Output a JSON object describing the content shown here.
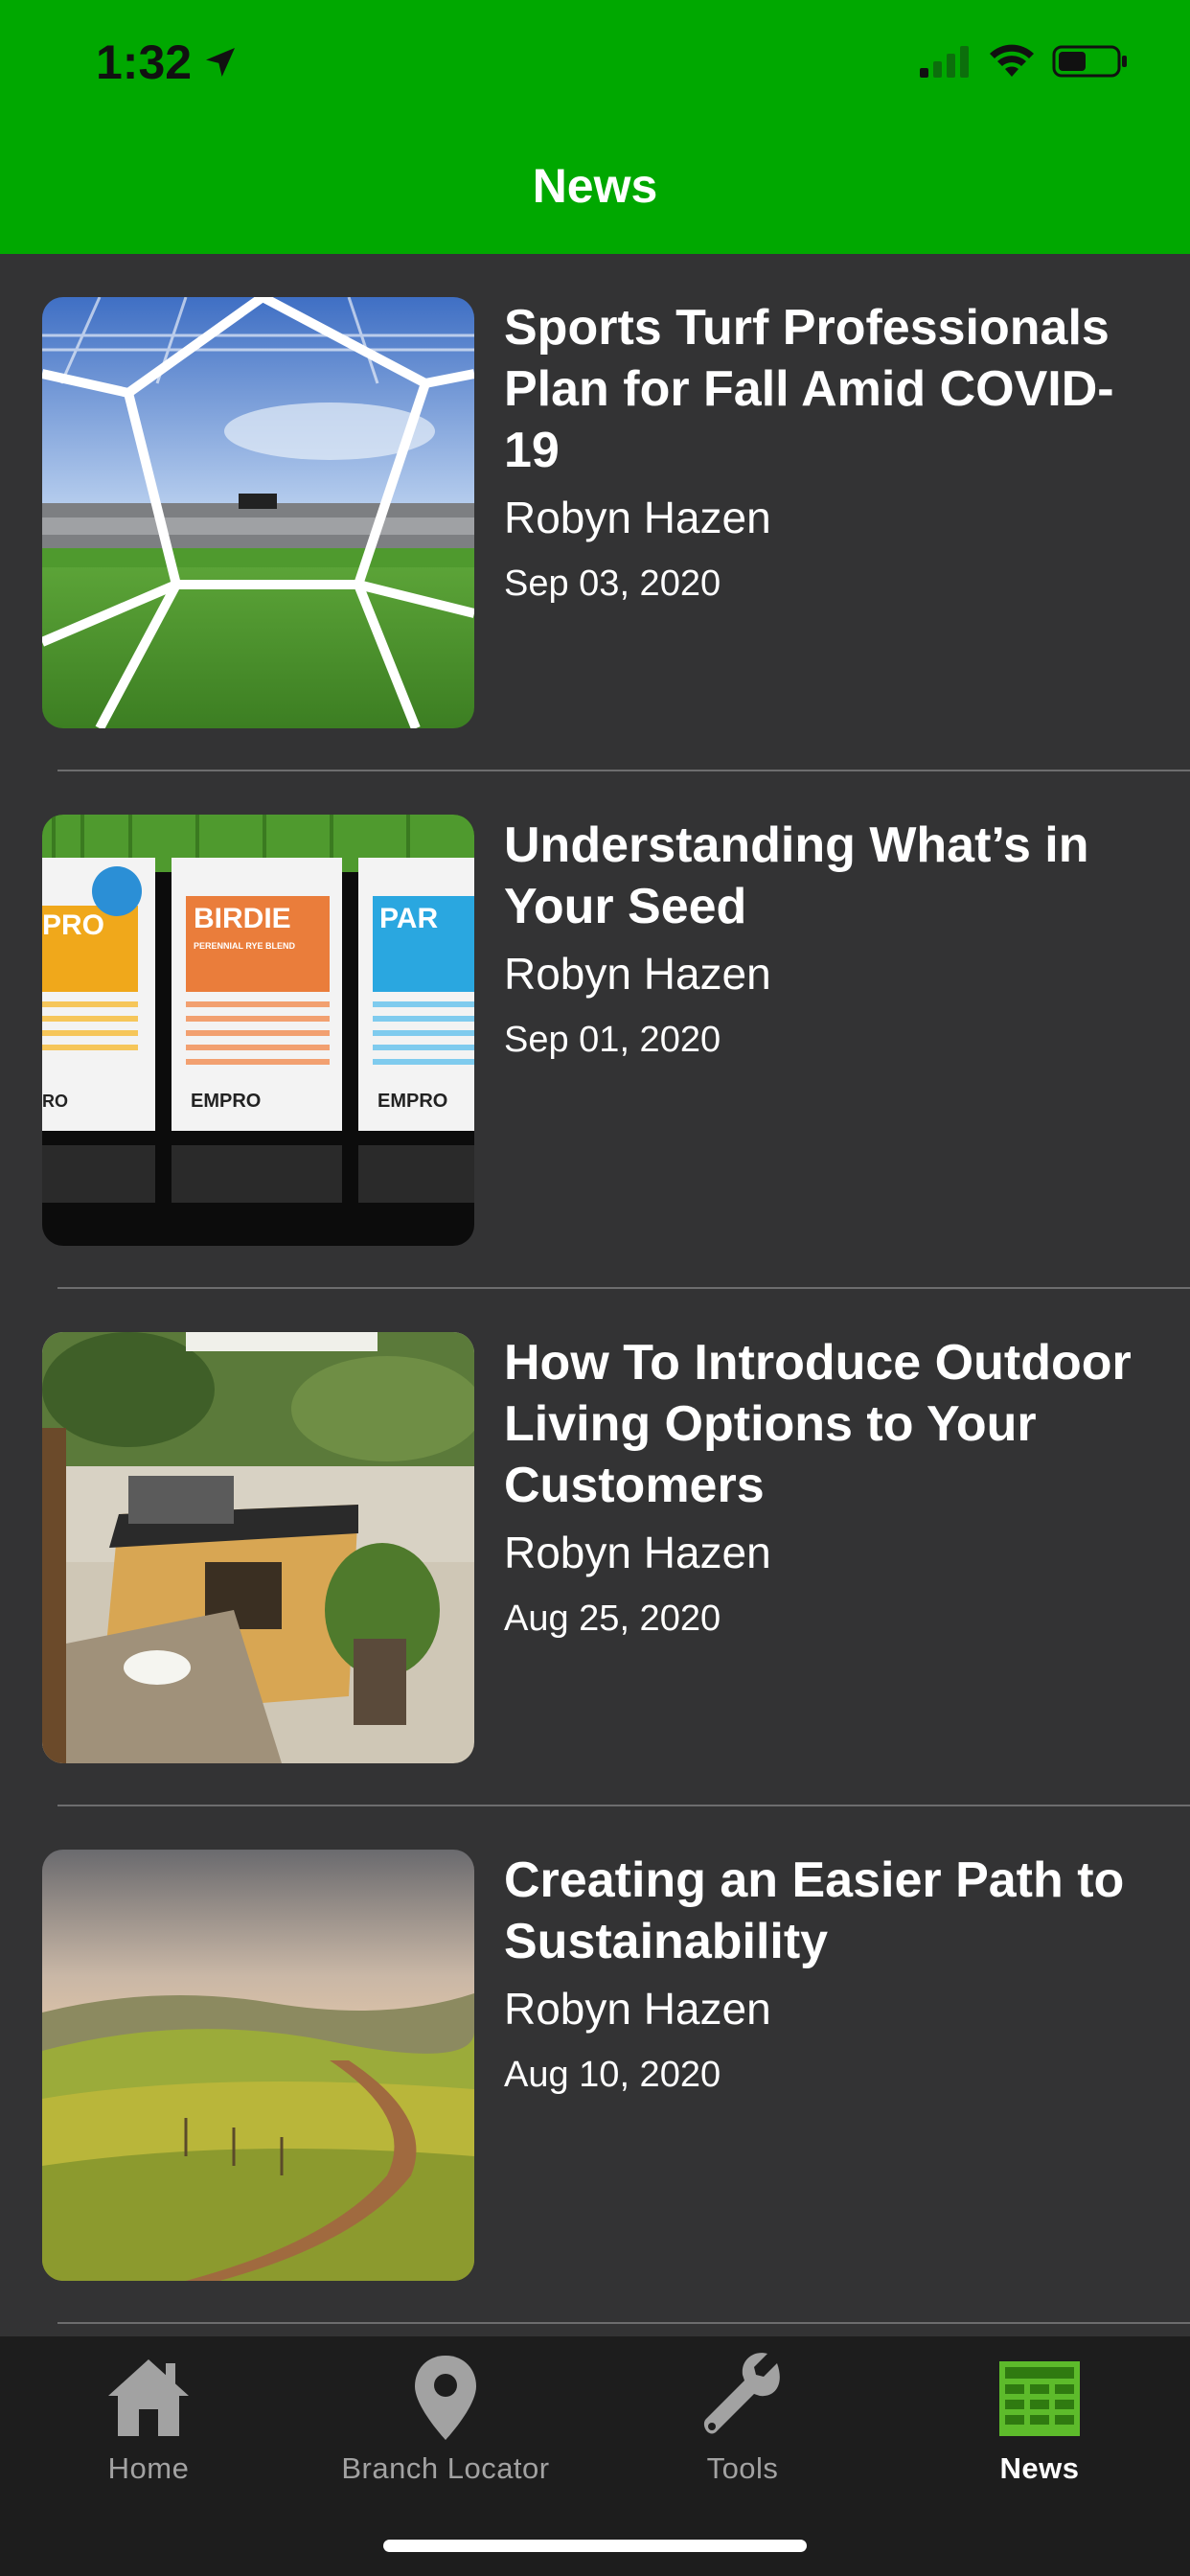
{
  "status_bar": {
    "time": "1:32",
    "location_icon": "location-arrow-icon",
    "signal_icon": "cellular-signal-icon",
    "wifi_icon": "wifi-icon",
    "battery_icon": "battery-icon"
  },
  "header": {
    "title": "News",
    "background_color": "#00a800"
  },
  "articles": [
    {
      "title": "Sports Turf Professionals Plan for Fall Amid COVID-19",
      "author": "Robyn Hazen",
      "date": "Sep 03, 2020",
      "image": "soccer-goal-stadium-image"
    },
    {
      "title": "Understanding What’s in Your Seed",
      "author": "Robyn Hazen",
      "date": "Sep 01, 2020",
      "image": "seed-bags-image",
      "image_text": {
        "bag_1": "PRO",
        "bag_2": "BIRDIE",
        "bag_2_sub": "PERENNIAL RYE BLEND",
        "bag_3": "PAR",
        "brand": "EMPRO"
      }
    },
    {
      "title": "How To Introduce Outdoor Living Options to Your Customers",
      "author": "Robyn Hazen",
      "date": "Aug 25, 2020",
      "image": "outdoor-kitchen-image"
    },
    {
      "title": "Creating an Easier Path to Sustainability",
      "author": "Robyn Hazen",
      "date": "Aug 10, 2020",
      "image": "green-hills-path-image"
    }
  ],
  "tabbar": {
    "tabs": [
      {
        "label": "Home",
        "icon": "home-icon",
        "active": false
      },
      {
        "label": "Branch Locator",
        "icon": "map-pin-icon",
        "active": false
      },
      {
        "label": "Tools",
        "icon": "wrench-icon",
        "active": false
      },
      {
        "label": "News",
        "icon": "newspaper-icon",
        "active": true
      }
    ],
    "inactive_color": "#a2a2a2",
    "active_color": "#ffffff",
    "news_icon_color": "#5dbb2b"
  }
}
